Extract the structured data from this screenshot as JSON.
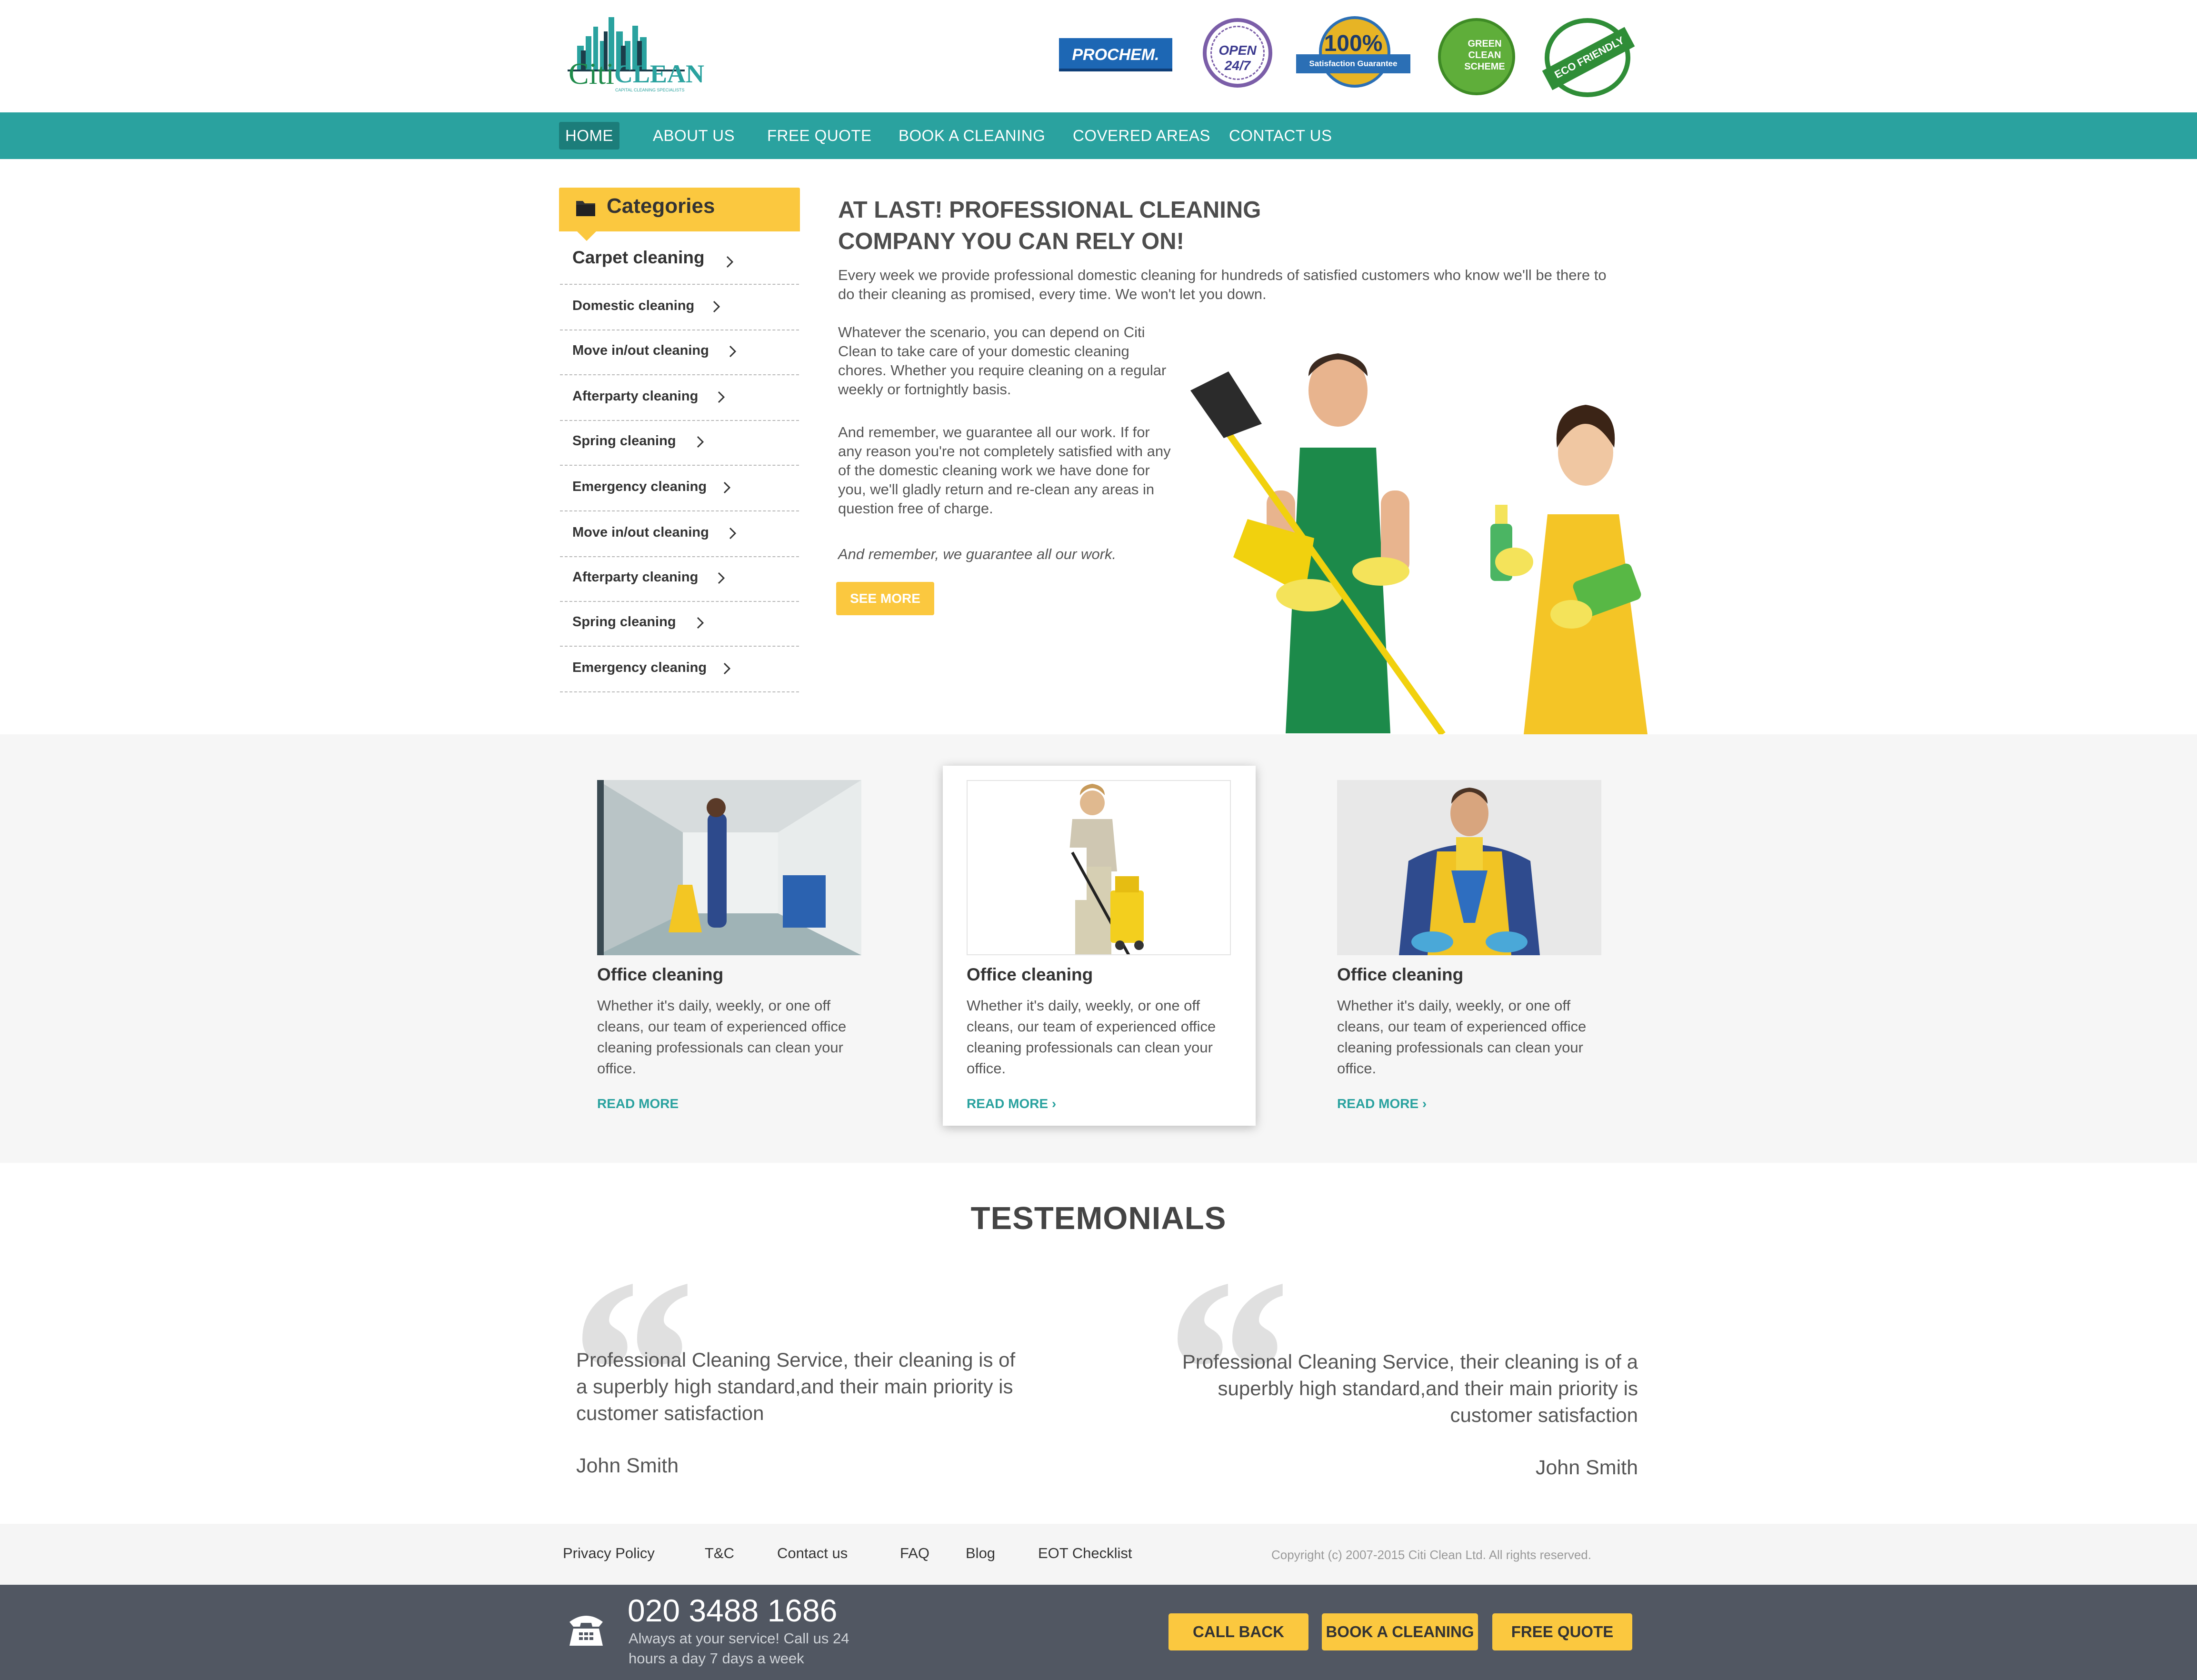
{
  "brand": {
    "name_part1": "Citi",
    "name_part2": "CLEAN",
    "tagline": "CAPITAL CLEANING SPECIALISTS"
  },
  "badges": [
    {
      "name": "prochem-badge",
      "text": "PROCHEM."
    },
    {
      "name": "open-24-7-badge",
      "text": "OPEN 24/7"
    },
    {
      "name": "satisfaction-guarantee-badge",
      "text": "100%",
      "sub": "Satisfaction Guarantee"
    },
    {
      "name": "green-clean-scheme-badge",
      "text": "GREEN CLEAN SCHEME"
    },
    {
      "name": "eco-friendly-badge",
      "text": "ECO FRIENDLY"
    }
  ],
  "nav": [
    "HOME",
    "ABOUT US",
    "FREE QUOTE",
    "BOOK A CLEANING",
    "COVERED AREAS",
    "CONTACT US"
  ],
  "categories": {
    "title": "Categories",
    "items": [
      "Carpet cleaning",
      "Domestic cleaning",
      "Move in/out cleaning",
      "Afterparty cleaning",
      "Spring cleaning",
      "Emergency cleaning",
      "Move in/out cleaning",
      "Afterparty cleaning",
      "Spring cleaning",
      "Emergency cleaning"
    ]
  },
  "intro": {
    "title_line1": "AT LAST! PROFESSIONAL CLEANING",
    "title_line2": "COMPANY YOU CAN RELY ON!",
    "p1": "Every week we provide professional domestic cleaning for hundreds of satisfied customers who know we'll be there to do their cleaning as promised, every time. We won't let you down.",
    "p2": "Whatever the scenario, you can depend on Citi Clean to take care of your domestic cleaning chores. Whether you require cleaning on a regular weekly or fortnightly basis.",
    "p3": "And remember, we guarantee all our work. If for any reason you're not completely satisfied with any of the domestic cleaning work we have done for you, we'll gladly return and re-clean any areas in question free of charge.",
    "p4": "And remember, we guarantee all our work.",
    "button": "SEE MORE"
  },
  "services": [
    {
      "title": "Office cleaning",
      "text": "Whether it's daily, weekly, or one off cleans, our team of experienced office cleaning professionals can clean your office.",
      "link": "READ MORE"
    },
    {
      "title": "Office cleaning",
      "text": "Whether it's daily, weekly, or one off cleans, our team of experienced office cleaning professionals can clean your office.",
      "link": "READ MORE ›"
    },
    {
      "title": "Office cleaning",
      "text": "Whether it's daily, weekly, or one off cleans, our team of experienced office cleaning professionals can clean your office.",
      "link": "READ MORE ›"
    }
  ],
  "testimonials": {
    "title": "TESTEMONIALS",
    "items": [
      {
        "quote": "Professional Cleaning Service, their cleaning is of a superbly high standard,and their main priority is customer satisfaction",
        "author": "John Smith"
      },
      {
        "quote": "Professional Cleaning Service, their cleaning is of a superbly high standard,and their main priority is customer satisfaction",
        "author": "John Smith"
      }
    ]
  },
  "footer_links": [
    "Privacy Policy",
    "T&C",
    "Contact us",
    "FAQ",
    "Blog",
    "EOT Checklist"
  ],
  "copyright": "Copyright (c) 2007-2015 Citi Clean Ltd. All rights reserved.",
  "contact": {
    "phone": "020 3488 1686",
    "subtitle": "Always at your service! Call us 24 hours a day 7 days a week",
    "buttons": [
      "CALL BACK",
      "BOOK A CLEANING",
      "FREE QUOTE"
    ]
  },
  "colors": {
    "teal": "#2aa29f",
    "yellow": "#fbc83f",
    "footer_dark": "#515762",
    "green": "#1e8a4a"
  }
}
